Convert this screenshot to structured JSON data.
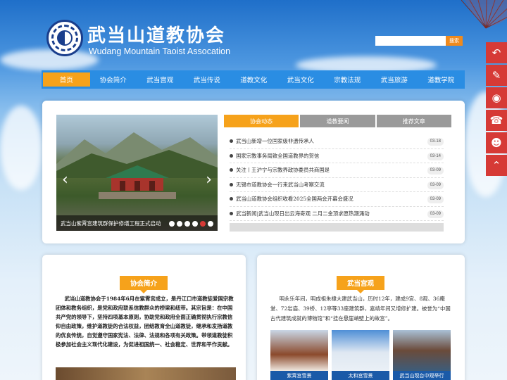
{
  "header": {
    "logo_cn": "武当山道教协会",
    "logo_en": "Wudang Mountain Taoist Assocation",
    "search_placeholder": "",
    "search_button": "搜索"
  },
  "sidebar_icons": [
    "back-icon",
    "chat-icon",
    "wechat-icon",
    "phone-icon",
    "qq-icon",
    "up-arrow-icon"
  ],
  "nav": {
    "items": [
      "首页",
      "协会简介",
      "武当宫观",
      "武当传说",
      "道教文化",
      "武当文化",
      "宗教法规",
      "武当旅游",
      "道教学院"
    ],
    "active_index": 0
  },
  "slider": {
    "caption": "武当山紫霄宫建筑群保护修缮工程正式启动",
    "dot_count": 6,
    "active_dot": 5
  },
  "news": {
    "tabs": [
      "协会动态",
      "道教要闻",
      "推荐文章"
    ],
    "active_tab": 0,
    "items": [
      {
        "title": "武当山新增一位国家级非遗传承人",
        "date": "03-18"
      },
      {
        "title": "国家宗教事务局致全国道教界的贺信",
        "date": "03-14"
      },
      {
        "title": "关注丨王沪宁与宗教界政协委员共商国是",
        "date": "03-09"
      },
      {
        "title": "无锡市道教协会一行来武当山考察交流",
        "date": "03-09"
      },
      {
        "title": "武当山道教协会组织收看2025全国两会开幕会盛况",
        "date": "03-09"
      },
      {
        "title": "武当新闻|武当山现日出云海奇观 二月二金顶求愿热潮涌动",
        "date": "03-09"
      }
    ]
  },
  "intro": {
    "title": "协会简介",
    "text": "武当山道教协会于1984年6月在紫霄宫成立，是丹江口市道教徒爱国宗教团体和教务组织，是党和政府联系信教群众的桥梁和纽带。其宗旨是：在中国共产党的领导下，坚持四项基本原则，协助党和政府全面正确贯彻执行宗教信仰自由政策，维护道教徒的合法权益，团结教育全山道教徒，继承和发扬道教的优良传统，自觉遵守国家宪法、法律、法规和各项有关政策。带领道教徒积极参加社会主义现代化建设，为促进祖国统一、社会稳定、世界和平作贡献。"
  },
  "gongguan": {
    "title": "武当宫观",
    "text": "明永乐年间，明成祖朱棣大建武当山，历时12年，建成9宫、8观、36庵堂、72岩庙、39桥、12亭等33座建筑群，嘉靖年间又增修扩建。被誉为“中国古代建筑成就的博物馆”和“挂在悬崖峭壁上的故宫”。",
    "thumbs": [
      "紫霄宫雪景",
      "太和宫雪景",
      "武当山现台中观举行"
    ]
  },
  "colors": {
    "accent": "#f6a21b",
    "nav_blue": "#2a8de3",
    "sidebar_red": "#d63a36"
  }
}
